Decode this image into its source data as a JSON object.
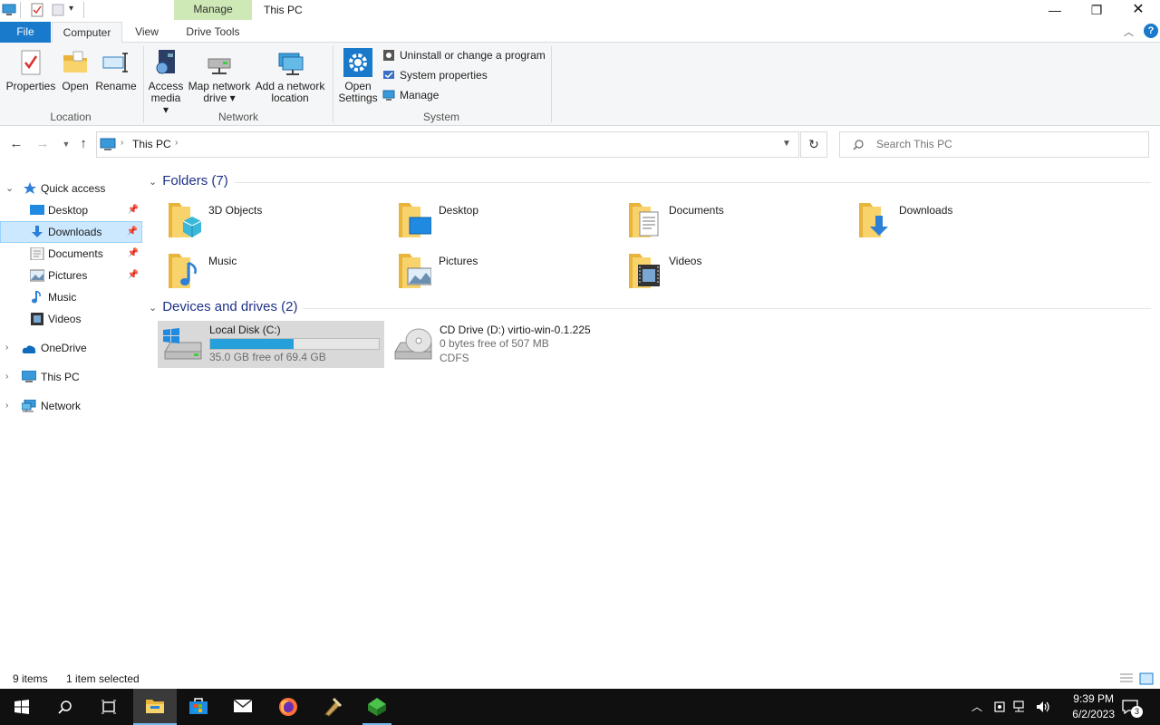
{
  "window": {
    "title": "This PC",
    "manage_label": "Manage"
  },
  "ribbon_tabs": {
    "file": "File",
    "computer": "Computer",
    "view": "View",
    "drive_tools": "Drive Tools"
  },
  "ribbon": {
    "location": {
      "label": "Location",
      "properties": "Properties",
      "open": "Open",
      "rename": "Rename"
    },
    "network": {
      "label": "Network",
      "access_media_1": "Access",
      "access_media_2": "media ▾",
      "map_drive_1": "Map network",
      "map_drive_2": "drive ▾",
      "add_location_1": "Add a network",
      "add_location_2": "location"
    },
    "system": {
      "label": "System",
      "open_settings_1": "Open",
      "open_settings_2": "Settings",
      "uninstall": "Uninstall or change a program",
      "system_properties": "System properties",
      "manage": "Manage"
    }
  },
  "address": {
    "path": "This PC",
    "search_placeholder": "Search This PC"
  },
  "navpane": {
    "quick_access": "Quick access",
    "items": [
      {
        "label": "Desktop",
        "pinned": true
      },
      {
        "label": "Downloads",
        "pinned": true,
        "selected": true
      },
      {
        "label": "Documents",
        "pinned": true
      },
      {
        "label": "Pictures",
        "pinned": true
      },
      {
        "label": "Music",
        "pinned": false
      },
      {
        "label": "Videos",
        "pinned": false
      }
    ],
    "onedrive": "OneDrive",
    "this_pc": "This PC",
    "network": "Network"
  },
  "content": {
    "folders_header": "Folders (7)",
    "folders": [
      "3D Objects",
      "Desktop",
      "Documents",
      "Downloads",
      "Music",
      "Pictures",
      "Videos"
    ],
    "drives_header": "Devices and drives (2)",
    "drives": [
      {
        "name": "Local Disk (C:)",
        "free": "35.0 GB free of 69.4 GB",
        "used_fraction": 0.496
      },
      {
        "name": "CD Drive (D:) virtio-win-0.1.225",
        "free": "0 bytes free of 507 MB",
        "fs": "CDFS"
      }
    ]
  },
  "status": {
    "items": "9 items",
    "selected": "1 item selected"
  },
  "taskbar": {
    "time": "9:39 PM",
    "date": "6/2/2023",
    "notifications": "3"
  },
  "colors": {
    "accent": "#1979ca",
    "selection": "#cce8ff",
    "manage_tab": "#cfe9b6",
    "drive_bar": "#26a0da",
    "taskbar": "#101010"
  }
}
